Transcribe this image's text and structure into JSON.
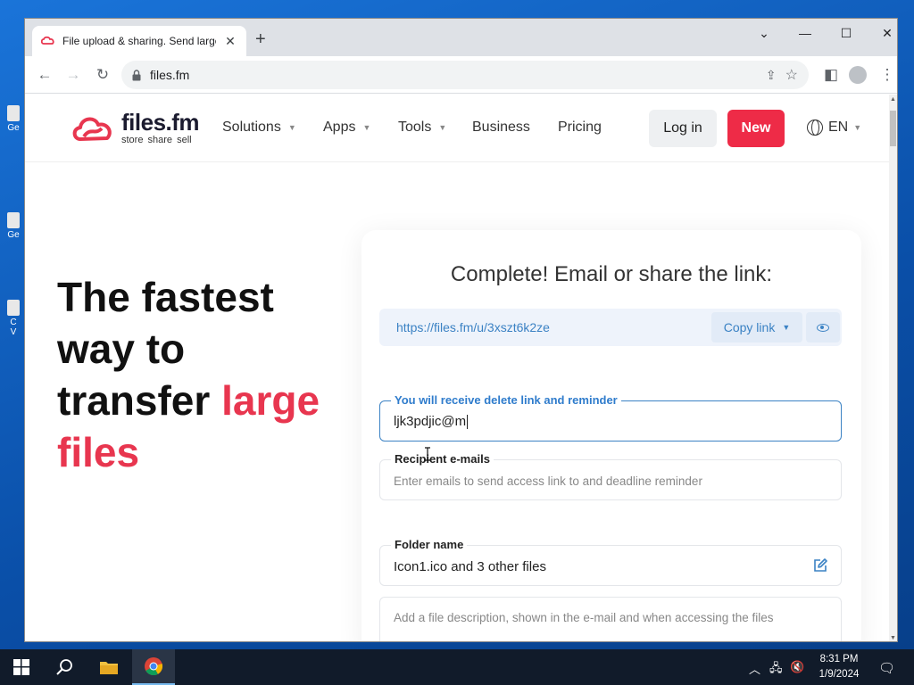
{
  "browser": {
    "tab_title": "File upload & sharing. Send large",
    "new_tab_symbol": "+",
    "url": "files.fm",
    "window_controls": {
      "minimize": "—",
      "maximize": "☐",
      "close": "✕",
      "tab_search": "⌄"
    }
  },
  "site": {
    "logo_name": "files.fm",
    "logo_tagline": "store share sell",
    "nav": [
      "Solutions",
      "Apps",
      "Tools",
      "Business",
      "Pricing"
    ],
    "login_label": "Log in",
    "new_label": "New",
    "language": "EN",
    "brand_color": "#ee2b47",
    "accent_blue": "#3b82c4"
  },
  "hero": {
    "line1": "The fastest",
    "line2": "way to",
    "line3_plain": "transfer ",
    "line3_accent": "large",
    "line4_accent": "files"
  },
  "share_card": {
    "title": "Complete! Email or share the link:",
    "link": "https://files.fm/u/3xszt6k2ze",
    "copy_label": "Copy link",
    "owner_field": {
      "label": "You will receive delete link and reminder",
      "value": "ljk3pdjic@m"
    },
    "recipient_field": {
      "label": "Recipient e-mails",
      "placeholder": "Enter emails to send access link to and deadline reminder"
    },
    "folder_field": {
      "label": "Folder name",
      "value": "Icon1.ico and 3 other files"
    },
    "description_field": {
      "placeholder": "Add a file description, shown in the e-mail and when accessing the files"
    }
  },
  "taskbar": {
    "time": "8:31 PM",
    "date": "1/9/2024",
    "pinned": [
      "start-icon",
      "search-icon",
      "file-explorer-icon",
      "chrome-icon"
    ]
  }
}
